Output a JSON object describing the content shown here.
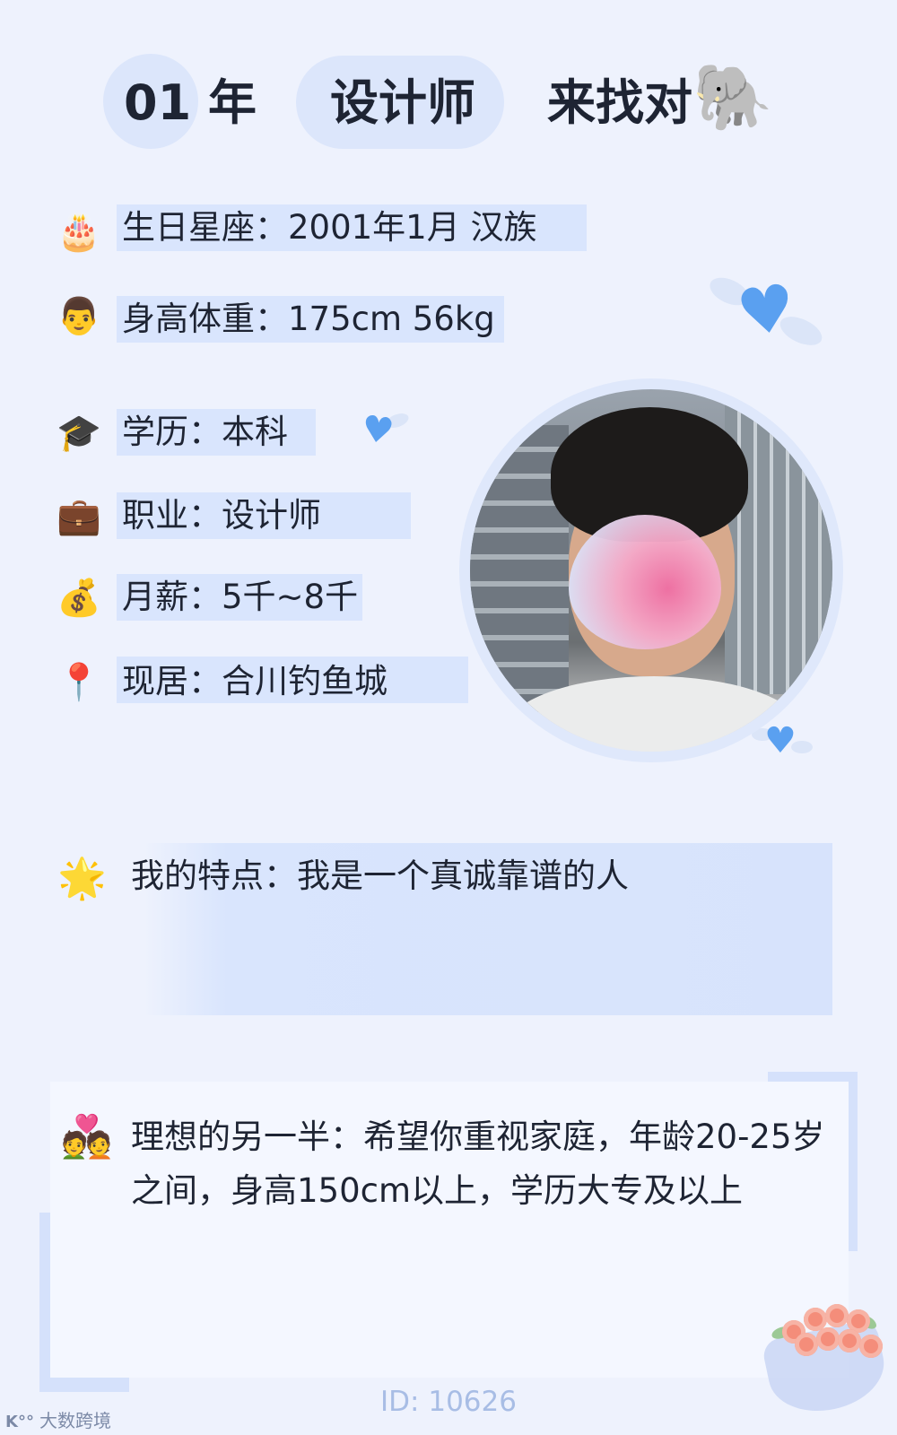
{
  "header": {
    "year_number": "01",
    "year_unit": "年",
    "occupation": "设计师",
    "slogan": "来找对",
    "slogan_emoji": "🐘"
  },
  "info_rows": [
    {
      "icon": "🎂",
      "icon_name": "birthday-cake-icon",
      "text": "生日星座：2001年1月 汉族"
    },
    {
      "icon": "👨",
      "icon_name": "man-face-icon",
      "text": "身高体重：175cm 56kg"
    },
    {
      "icon": "🎓",
      "icon_name": "graduation-cap-icon",
      "text": "学历：本科"
    },
    {
      "icon": "💼",
      "icon_name": "briefcase-icon",
      "text": "职业：设计师"
    },
    {
      "icon": "💰",
      "icon_name": "money-bag-icon",
      "text": "月薪：5千~8千"
    },
    {
      "icon": "📍",
      "icon_name": "location-pin-icon",
      "text": "现居：合川钓鱼城"
    }
  ],
  "trait": {
    "icon": "🌟",
    "text": "我的特点：我是一个真诚靠谱的人"
  },
  "ideal": {
    "icon": "💑",
    "text": "理想的另一半：希望你重视家庭，年龄20-25岁之间，身高150cm以上，学历大专及以上"
  },
  "footer": {
    "id_text": "ID: 10626",
    "watermark_logo": "K°°",
    "watermark_text": "大数跨境"
  },
  "colors": {
    "background": "#eef2fd",
    "highlight": "#d9e5fd",
    "heart_blue": "#5aa0f0",
    "id_text": "#a8bde5"
  }
}
